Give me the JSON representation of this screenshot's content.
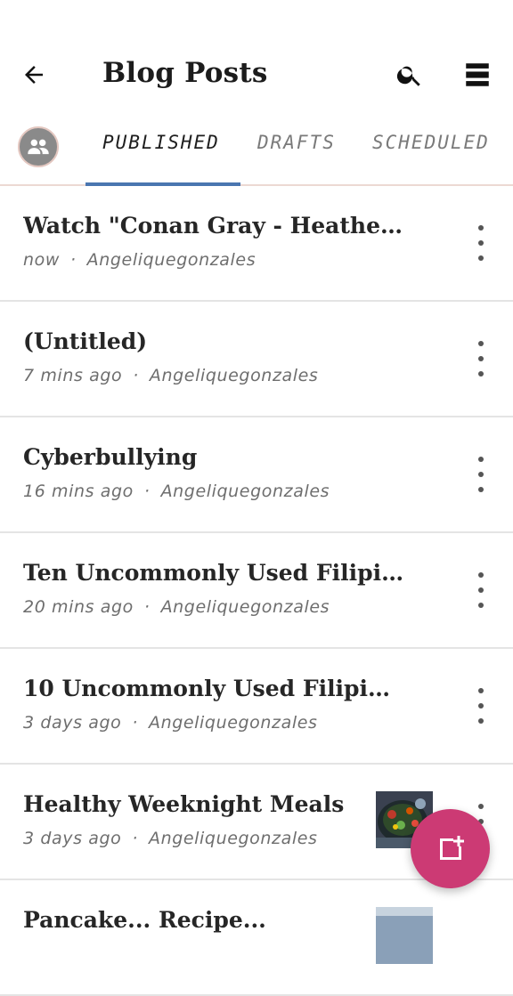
{
  "app_bar": {
    "title": "Blog Posts",
    "back_icon": "arrow-left-icon",
    "search_icon": "search-icon",
    "view_toggle_icon": "view-list-icon"
  },
  "tabs": [
    {
      "label": "PUBLISHED",
      "active": true
    },
    {
      "label": "DRAFTS",
      "active": false
    },
    {
      "label": "SCHEDULED",
      "active": false
    }
  ],
  "posts": [
    {
      "title": "Watch \"Conan Gray - Heather...",
      "time": "now",
      "author": "Angeliquegonzales",
      "has_thumbnail": false
    },
    {
      "title": "(Untitled)",
      "time": "7 mins ago",
      "author": "Angeliquegonzales",
      "has_thumbnail": false
    },
    {
      "title": "Cyberbullying",
      "time": "16 mins ago",
      "author": "Angeliquegonzales",
      "has_thumbnail": false
    },
    {
      "title": "Ten Uncommonly Used Filipino...",
      "time": "20 mins ago",
      "author": "Angeliquegonzales",
      "has_thumbnail": false
    },
    {
      "title": "10 Uncommonly Used Filipino...",
      "time": "3 days ago",
      "author": "Angeliquegonzales",
      "has_thumbnail": false
    },
    {
      "title": "Healthy Weeknight Meals",
      "time": "3 days ago",
      "author": "Angeliquegonzales",
      "has_thumbnail": true
    },
    {
      "title": "Pancake... Recipe...",
      "time": "",
      "author": "",
      "has_thumbnail": true
    }
  ],
  "separator": "·",
  "fab": {
    "icon": "new-post-icon"
  },
  "colors": {
    "accent": "#4a76b0",
    "fab": "#cc3a74",
    "divider": "#e4e4e4"
  }
}
